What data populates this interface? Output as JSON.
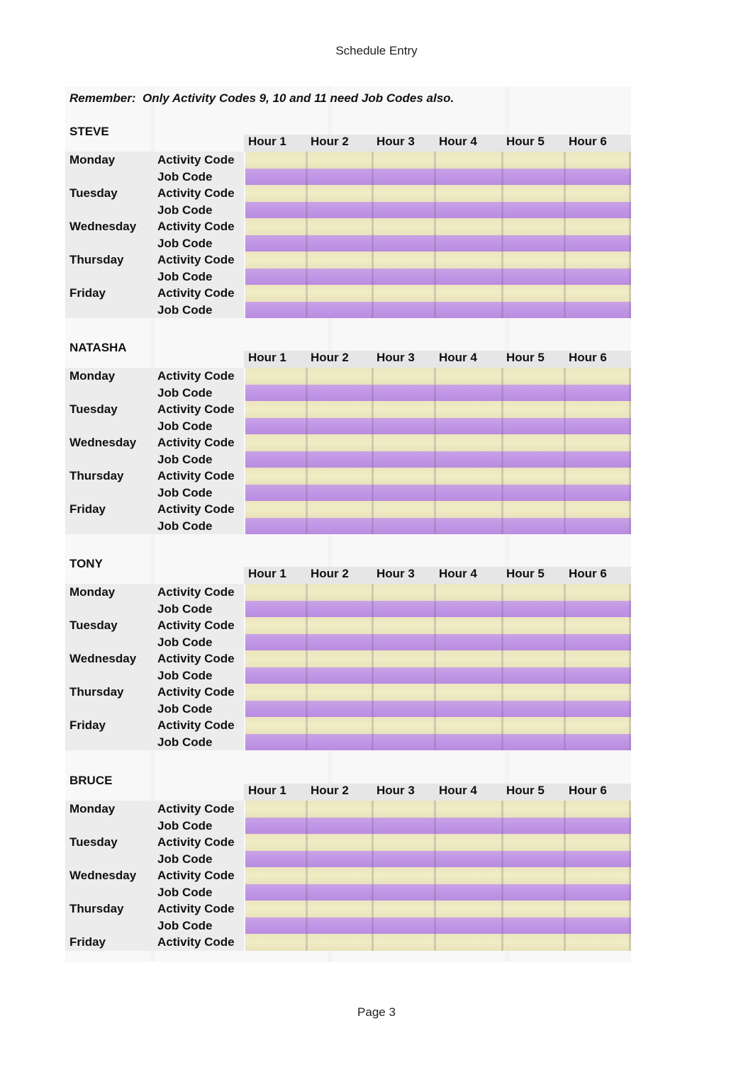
{
  "page": {
    "header": "Schedule Entry",
    "footer": "Page 3"
  },
  "reminder": "Remember:  Only Activity Codes 9, 10 and 11 need Job Codes also.",
  "hours": [
    "Hour 1",
    "Hour 2",
    "Hour 3",
    "Hour 4",
    "Hour 5",
    "Hour 6"
  ],
  "row_labels": {
    "activity": "Activity Code",
    "job": "Job Code"
  },
  "colors": {
    "activity_fill": "#EEE8C1",
    "job_fill": "#C197E6"
  },
  "sections": [
    {
      "name": "STEVE",
      "days": [
        "Monday",
        "Tuesday",
        "Wednesday",
        "Thursday",
        "Friday"
      ],
      "last_day_job_row": true
    },
    {
      "name": "NATASHA",
      "days": [
        "Monday",
        "Tuesday",
        "Wednesday",
        "Thursday",
        "Friday"
      ],
      "last_day_job_row": true
    },
    {
      "name": "TONY",
      "days": [
        "Monday",
        "Tuesday",
        "Wednesday",
        "Thursday",
        "Friday"
      ],
      "last_day_job_row": true
    },
    {
      "name": "BRUCE",
      "days": [
        "Monday",
        "Tuesday",
        "Wednesday",
        "Thursday",
        "Friday"
      ],
      "last_day_job_row": false
    }
  ]
}
